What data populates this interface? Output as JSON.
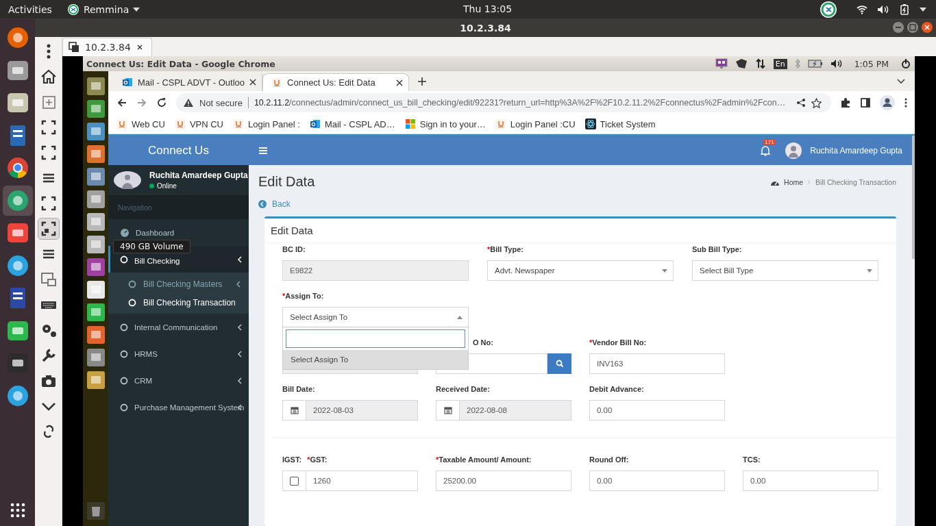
{
  "topbar": {
    "activities": "Activities",
    "app": "Remmina",
    "clock": "Thu 13:05"
  },
  "remmina": {
    "title": "10.2.3.84",
    "tab": "10.2.3.84"
  },
  "launcher_tooltip": "490 GB Volume",
  "chrome": {
    "title": "Connect Us: Edit Data - Google Chrome",
    "tray_lang": "En",
    "tray_clock": "1:05 PM",
    "tabs": [
      {
        "title": "Mail - CSPL ADVT - Outloo",
        "selected": false
      },
      {
        "title": "Connect Us: Edit Data",
        "selected": true
      }
    ],
    "security": "Not secure",
    "url_host": "10.2.11.2",
    "url_path": "/connectus/admin/connect_us_bill_checking/edit/92231?return_url=http%3A%2F%2F10.2.11.2%2Fconnectus%2Fadmin%2Fcon…",
    "bookmarks": [
      "Web CU",
      "VPN CU",
      "Login Panel :",
      "Mail - CSPL AD…",
      "Sign in to your…",
      "Login Panel :CU",
      "Ticket System"
    ]
  },
  "app": {
    "brand": "Connect Us",
    "notification_count": "171",
    "header_user": "Ruchita Amardeep Gupta",
    "sidebar": {
      "user": "Ruchita Amardeep Gupta",
      "status": "Online",
      "section": "Navigation",
      "items": [
        {
          "label": "Dashboard",
          "submenu": false,
          "selected": false
        },
        {
          "label": "Bill Checking",
          "submenu": true,
          "selected": true,
          "children": [
            {
              "label": "Bill Checking Masters",
              "submenu": true,
              "selected": false
            },
            {
              "label": "Bill Checking Transaction",
              "submenu": false,
              "selected": true
            }
          ]
        },
        {
          "label": "Internal Communication",
          "submenu": true,
          "selected": false
        },
        {
          "label": "HRMS",
          "submenu": true,
          "selected": false
        },
        {
          "label": "CRM",
          "submenu": true,
          "selected": false
        },
        {
          "label": "Purchase Management System",
          "submenu": true,
          "selected": false
        }
      ]
    },
    "page_title": "Edit Data",
    "back": "Back",
    "breadcrumb": [
      "Home",
      "Bill Checking Transaction"
    ],
    "form": {
      "title": "Edit Data",
      "rows": [
        {
          "kind": "wide",
          "fields": [
            {
              "label": "BC ID:",
              "kind": "text",
              "readonly": true,
              "value": "E9822"
            },
            {
              "mark": "*",
              "label": "Bill Type:",
              "kind": "select",
              "value": "Advt. Newspaper"
            },
            {
              "label": "Sub Bill Type:",
              "kind": "select",
              "value": "Select Bill Type"
            }
          ]
        },
        {
          "kind": "wide",
          "fields": [
            {
              "mark": "*",
              "label": "Assign To:",
              "kind": "select",
              "value": "Select Assign To",
              "open": true,
              "options": [
                {
                  "label": "Select Assign To",
                  "selected": true
                }
              ]
            }
          ]
        },
        {
          "kind": "narrow",
          "fields": [
            {
              "kind": "text",
              "readonly": true
            },
            {
              "label": "O No:",
              "kind": "search"
            },
            {
              "mark": "*",
              "label": "Vendor Bill No:",
              "kind": "text",
              "value": "INV163"
            }
          ]
        },
        {
          "kind": "narrow",
          "fields": [
            {
              "label": "Bill Date:",
              "kind": "date",
              "readonly": true,
              "value": "2022-08-03"
            },
            {
              "label": "Received Date:",
              "kind": "date",
              "readonly": true,
              "value": "2022-08-08"
            },
            {
              "label": "Debit Advance:",
              "kind": "text",
              "value": "0.00"
            }
          ]
        },
        {
          "kind": "divider"
        },
        {
          "kind": "narrow",
          "fields": [
            {
              "kind": "checkgroup",
              "check_label": "IGST:",
              "checked": false,
              "mark": "*",
              "label": "GST:",
              "value": "1260"
            },
            {
              "mark": "*",
              "label": "Taxable Amount/ Amount:",
              "kind": "text",
              "value": "25200.00"
            },
            {
              "label": "Round Off:",
              "kind": "text",
              "value": "0.00"
            },
            {
              "label": "TCS:",
              "kind": "text",
              "value": "0.00"
            }
          ]
        }
      ]
    }
  }
}
